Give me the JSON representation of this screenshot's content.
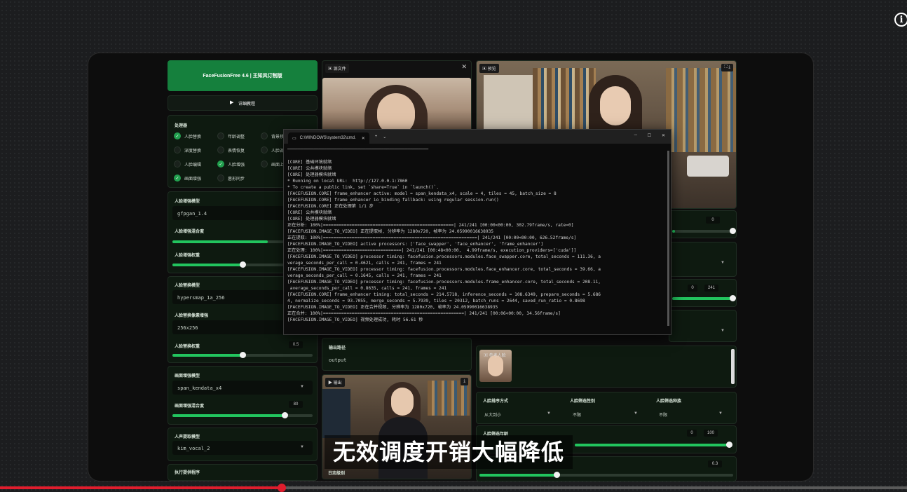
{
  "app_title": "FaceFusionFree 4.6 | 王知风订制版",
  "tutorial_button": "详细教程",
  "processors": {
    "label": "处理器",
    "items": [
      {
        "label": "人脸替换",
        "checked": true
      },
      {
        "label": "年龄调整",
        "checked": false
      },
      {
        "label": "背景移除",
        "checked": false
      },
      {
        "label": "深度替换",
        "checked": false
      },
      {
        "label": "表情恢复",
        "checked": false
      },
      {
        "label": "人脸调试",
        "checked": false
      },
      {
        "label": "人脸编辑",
        "checked": false
      },
      {
        "label": "人脸增强",
        "checked": true
      },
      {
        "label": "画面上色",
        "checked": false
      },
      {
        "label": "画面增强",
        "checked": true
      },
      {
        "label": "唇形同步",
        "checked": false
      }
    ]
  },
  "face_enhancer": {
    "model_label": "人脸增强模型",
    "model_value": "gfpgan_1.4",
    "blend_label": "人脸增强混合度",
    "weight_label": "人脸增强权重"
  },
  "face_swapper": {
    "model_label": "人脸替换模型",
    "model_value": "hypersmap_1a_256",
    "pixel_boost_label": "人脸替换像素增强",
    "pixel_boost_value": "256x256",
    "weight_label": "人脸替换权重",
    "weight_value": "0.5"
  },
  "frame_enhancer": {
    "model_label": "画面增强模型",
    "model_value": "span_kendata_x4",
    "blend_label": "画面增强混合度",
    "blend_value": "80"
  },
  "voice_extractor": {
    "model_label": "人声提取模型",
    "model_value": "kim_vocal_2"
  },
  "execution_label": "执行提供程序",
  "source_tab": "源文件",
  "preview_tab": "预览",
  "output_tab": "输出",
  "output_path_label": "输出路径",
  "output_path_value": "output",
  "log_level_label": "日志级别",
  "reference_face_label": "参考人脸",
  "face_selector": {
    "order_label": "人脸排序方式",
    "order_value": "从大到小",
    "gender_label": "人脸筛选性别",
    "gender_value": "不限",
    "race_label": "人脸筛选种族",
    "race_value": "不限",
    "age_label": "人脸筛选年龄",
    "age_min": "0",
    "age_max": "100",
    "extra_value": "0.3"
  },
  "right_values": {
    "top_num": "0",
    "trim_start": "0",
    "trim_end": "241"
  },
  "terminal": {
    "tab_title": "C:\\WINDOWS\\system32\\cmd.",
    "lines": [
      "──────────────────────────────────────────────────────",
      "",
      "[CORE] 基础环境就绪",
      "[CORE] 公共模块就绪",
      "[CORE] 处理器模块就绪",
      "* Running on local URL:  http://127.0.0.1:7860",
      "* To create a public link, set `share=True` in `launch()`.",
      "[FACEFUSION.CORE] frame_enhancer active: model = span_kendata_x4, scale = 4, tiles = 45, batch_size = 8",
      "[FACEFUSION.CORE] frame_enhancer io_binding fallback: using regular session.run()",
      "[FACEFUSION.CORE] 正在处理第 1/1 步",
      "[CORE] 公共模块就绪",
      "[CORE] 处理器模块就绪",
      "正在分析: 100%|==================================================| 241/241 [00:00<00:00, 302.79frame/s, rate=0]",
      "[FACEFUSION.IMAGE_TO_VIDEO] 正在提取帧, 分辨率为 1280x720, 帧率为 24.05990016638935",
      "正在提取: 100%|===========================================================| 241/241 [00:00<00:00, 626.52frame/s]",
      "[FACEFUSION.IMAGE_TO_VIDEO] active processors: ['face_swapper', 'face_enhancer', 'frame_enhancer']",
      "正在处理: 100%|==============================| 241/241 [00:48<00:00,  4.99frame/s, execution_providers=['cuda']]",
      "[FACEFUSION.IMAGE_TO_VIDEO] processor timing: facefusion.processors.modules.face_swapper.core, total_seconds = 111.36, a",
      "verage_seconds_per_call = 0.4621, calls = 241, frames = 241",
      "[FACEFUSION.IMAGE_TO_VIDEO] processor timing: facefusion.processors.modules.face_enhancer.core, total_seconds = 39.66, a",
      "verage_seconds_per_call = 0.1645, calls = 241, frames = 241",
      "[FACEFUSION.IMAGE_TO_VIDEO] processor timing: facefusion.processors.modules.frame_enhancer.core, total_seconds = 208.11,",
      " average_seconds_per_call = 0.8635, calls = 241, frames = 241",
      "[FACEFUSION.CORE] frame_enhancer timing: total_seconds = 214.5718, inference_seconds = 108.6349, prepare_seconds = 5.686",
      "4, normalize_seconds = 93.7055, merge_seconds = 5.7939, tiles = 20312, batch_runs = 2644, saved_run_ratio = 0.8698",
      "[FACEFUSION.IMAGE_TO_VIDEO] 正在合并视频, 分辨率为 1280x720, 帧率为 24.05990016638935",
      "正在合并: 100%|======================================================| 241/241 [00:06<00:00, 34.56frame/s]",
      "[FACEFUSION.IMAGE_TO_VIDEO] 视频处理成功, 耗时 56.61 秒"
    ]
  },
  "subtitle": "无效调度开销大幅降低",
  "progress": 0.311,
  "colors": {
    "accent": "#22c55e",
    "title_bg": "#15803d",
    "progress": "#e01d2d"
  }
}
